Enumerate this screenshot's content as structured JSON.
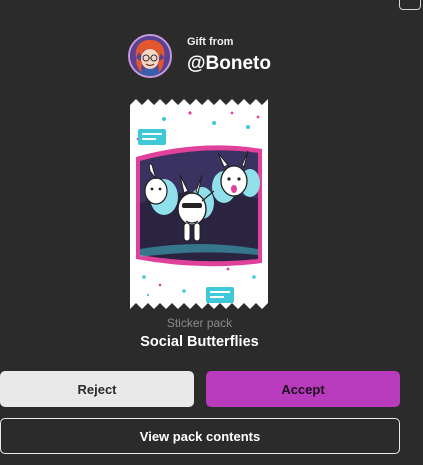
{
  "gift": {
    "label": "Gift from",
    "sender": "@Boneto"
  },
  "pack": {
    "type_label": "Sticker pack",
    "name": "Social Butterflies"
  },
  "actions": {
    "reject": "Reject",
    "accept": "Accept",
    "view": "View pack contents"
  },
  "colors": {
    "background": "#2b2b2b",
    "accept": "#b93bbd",
    "reject": "#e9e9e9",
    "pack_accent_cyan": "#3fc8d8",
    "pack_accent_pink": "#e0429b"
  },
  "icons": {
    "avatar": "user-avatar-redhead",
    "corner": "window-control-outline"
  }
}
